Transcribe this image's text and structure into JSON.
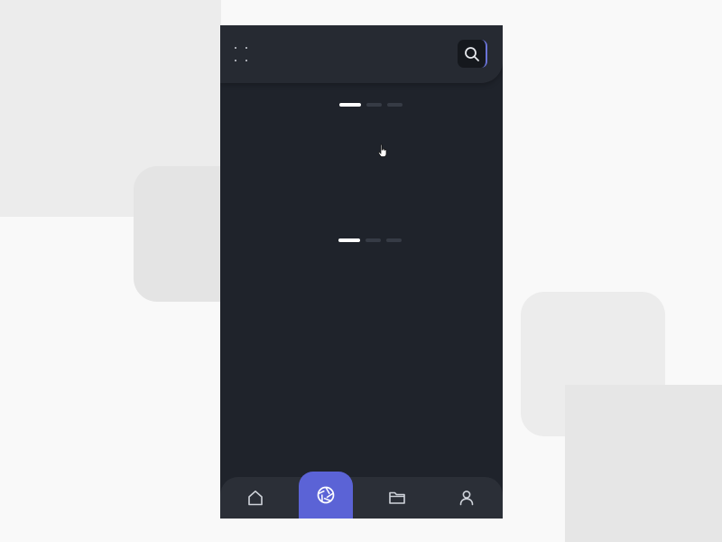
{
  "theme": {
    "page_background": "#f9f9f9",
    "phone_background": "#1f232b",
    "top_bar_background": "#262a32",
    "nav_background": "#2b2f37",
    "accent": "#5b63d6",
    "icon_color": "#cfd3da"
  },
  "header": {
    "menu_icon": "menu-dots-icon",
    "search_icon": "search-icon"
  },
  "carousels": [
    {
      "slides": 3,
      "active_index": 0
    },
    {
      "slides": 3,
      "active_index": 0
    }
  ],
  "bottom_nav": {
    "items": [
      {
        "icon": "home-icon",
        "active": false
      },
      {
        "icon": "aperture-icon",
        "active": true
      },
      {
        "icon": "folder-icon",
        "active": false
      },
      {
        "icon": "user-icon",
        "active": false
      }
    ]
  }
}
